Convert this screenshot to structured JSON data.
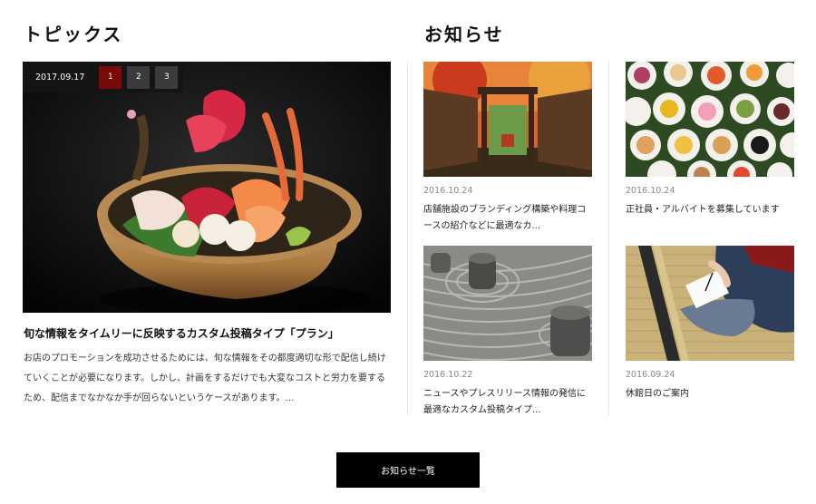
{
  "topics": {
    "heading": "トピックス",
    "slider": {
      "date": "2017.09.17",
      "pages": [
        "1",
        "2",
        "3"
      ],
      "active_page": "1"
    },
    "headline": "旬な情報をタイムリーに反映するカスタム投稿タイプ「プラン」",
    "excerpt_lines": [
      "お店のプロモーションを成功させるためには、旬な情報をその都度適切な形で配信し続け",
      "ていくことが必要になります。しかし、計画をするだけでも大変なコストと労力を要する",
      "ため、配信までなかなか手が回らないというケースがあります。…"
    ]
  },
  "news": {
    "heading": "お知らせ",
    "items": [
      {
        "date": "2016.10.24",
        "title_lines": [
          "店舗施設のブランディング構築や料理コ",
          "ースの紹介などに最適なカ..."
        ]
      },
      {
        "date": "2016.10.24",
        "title_lines": [
          "正社員・アルバイトを募集しています"
        ]
      },
      {
        "date": "2016.10.22",
        "title_lines": [
          "ニュースやプレスリリース情報の発信に",
          "最適なカスタム投稿タイプ..."
        ]
      },
      {
        "date": "2016.09.24",
        "title_lines": [
          "休館日のご案内"
        ]
      }
    ],
    "more_label": "お知らせ一覧"
  }
}
